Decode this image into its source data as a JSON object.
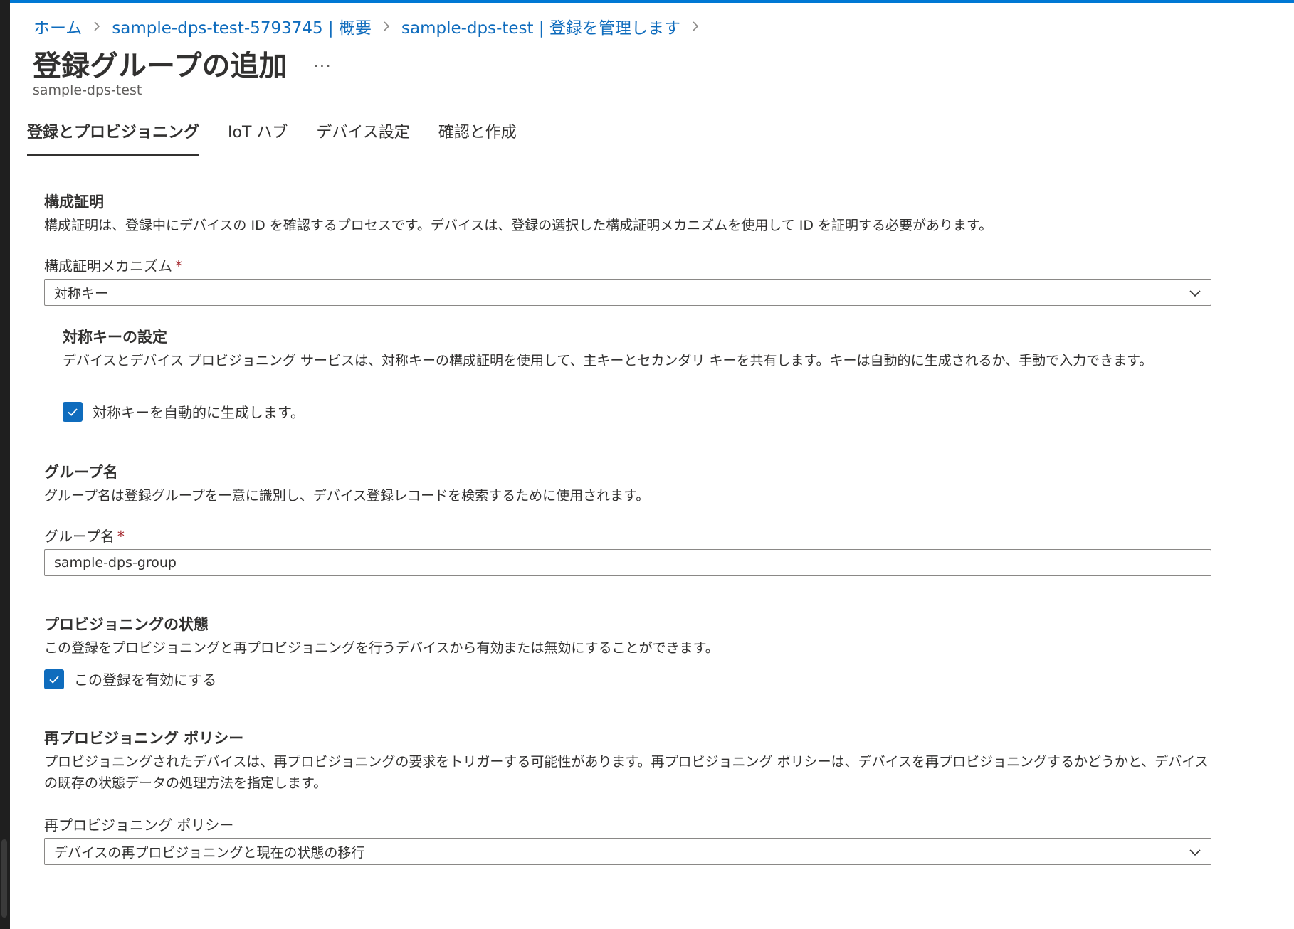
{
  "breadcrumb": {
    "items": [
      "ホーム",
      "sample-dps-test-5793745 | 概要",
      "sample-dps-test | 登録を管理します"
    ]
  },
  "page": {
    "title": "登録グループの追加",
    "more_label": "...",
    "subtitle": "sample-dps-test"
  },
  "tabs": [
    {
      "label": "登録とプロビジョニング",
      "active": true
    },
    {
      "label": "IoT ハブ",
      "active": false
    },
    {
      "label": "デバイス設定",
      "active": false
    },
    {
      "label": "確認と作成",
      "active": false
    }
  ],
  "attestation": {
    "heading": "構成証明",
    "description": "構成証明は、登録中にデバイスの ID を確認するプロセスです。デバイスは、登録の選択した構成証明メカニズムを使用して ID を証明する必要があります。",
    "mechanism_label": "構成証明メカニズム",
    "required_mark": "*",
    "mechanism_value": "対称キー"
  },
  "symmetric_key": {
    "heading": "対称キーの設定",
    "description": "デバイスとデバイス プロビジョニング サービスは、対称キーの構成証明を使用して、主キーとセカンダリ キーを共有します。キーは自動的に生成されるか、手動で入力できます。",
    "auto_generate_label": "対称キーを自動的に生成します。",
    "auto_generate_checked": true
  },
  "group_name": {
    "heading": "グループ名",
    "description": "グループ名は登録グループを一意に識別し、デバイス登録レコードを検索するために使用されます。",
    "label": "グループ名",
    "required_mark": "*",
    "value": "sample-dps-group"
  },
  "provisioning_status": {
    "heading": "プロビジョニングの状態",
    "description": "この登録をプロビジョニングと再プロビジョニングを行うデバイスから有効または無効にすることができます。",
    "enable_label": "この登録を有効にする",
    "enable_checked": true
  },
  "reprovision_policy": {
    "heading": "再プロビジョニング ポリシー",
    "description": "プロビジョニングされたデバイスは、再プロビジョニングの要求をトリガーする可能性があります。再プロビジョニング ポリシーは、デバイスを再プロビジョニングするかどうかと、デバイスの既存の状態データの処理方法を指定します。",
    "label": "再プロビジョニング ポリシー",
    "value": "デバイスの再プロビジョニングと現在の状態の移行"
  },
  "colors": {
    "accent": "#0f6cbd",
    "top_line": "#0078d4",
    "required": "#a4262c"
  },
  "icons": {
    "breadcrumb_separator": "chevron-right-icon",
    "select_arrow": "chevron-down-icon",
    "checkbox": "checkmark-icon"
  }
}
